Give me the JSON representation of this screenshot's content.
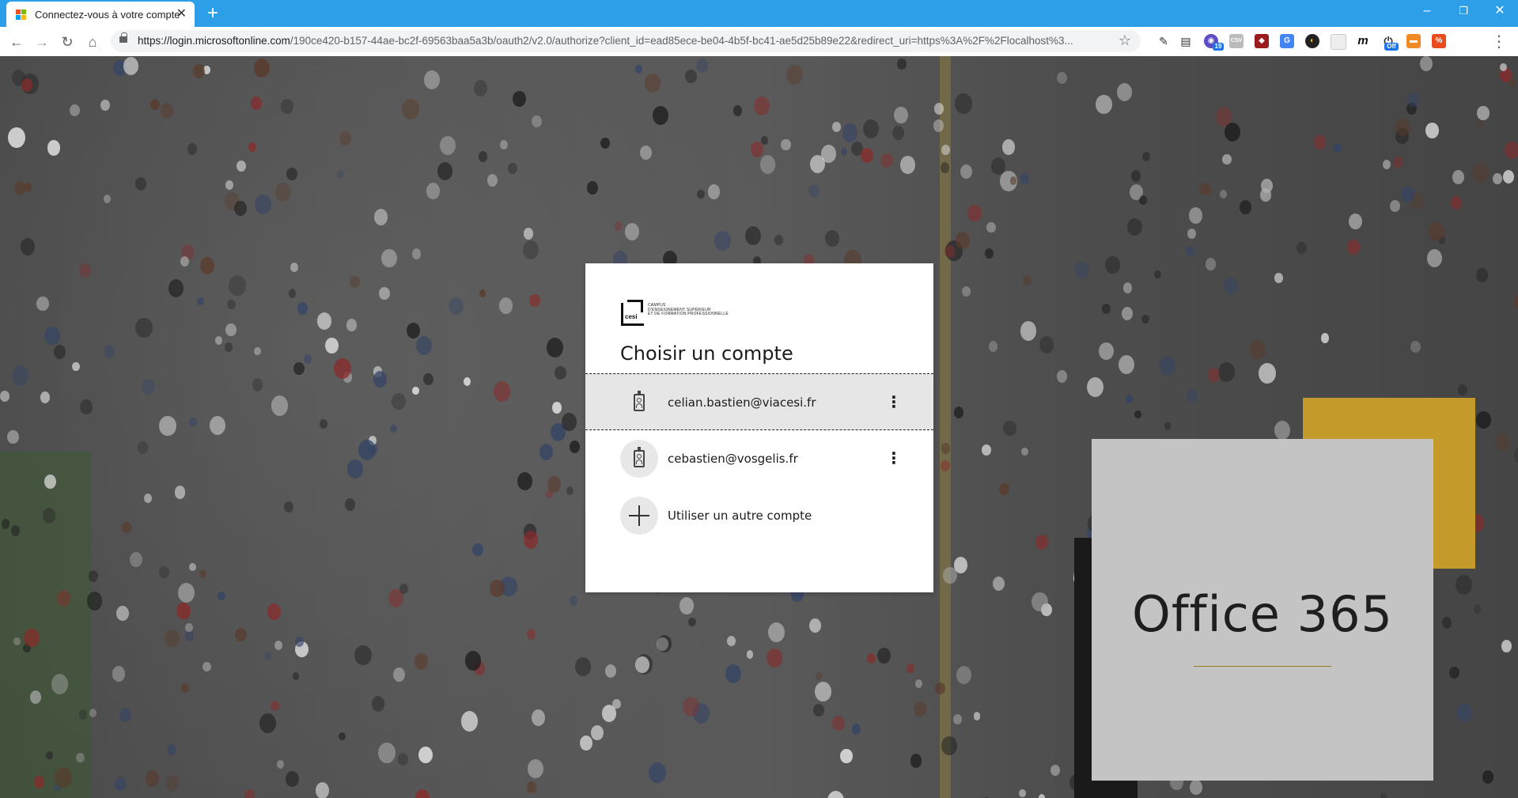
{
  "browser": {
    "tab_title": "Connectez-vous à votre compte",
    "tab_close": "✕",
    "new_tab": "+",
    "window_controls": {
      "minimize": "–",
      "restore": "❐",
      "close": "✕"
    },
    "url_host": "https://login.microsoftonline.com",
    "url_path": "/190ce420-b157-44ae-bc2f-69563baa5a3b/oauth2/v2.0/authorize?client_id=ead85ece-be04-4b5f-bc41-ae5d25b89e22&redirect_uri=https%3A%2F%2Flocalhost%3...",
    "extension_badges": [
      "19",
      "Off"
    ]
  },
  "login": {
    "logo_mark": "cesi",
    "logo_text_lines": [
      "CAMPUS",
      "D'ENSEIGNEMENT SUPÉRIEUR",
      "ET DE FORMATION PROFESSIONNELLE"
    ],
    "heading": "Choisir un compte",
    "accounts": [
      {
        "email": "celian.bastien@viacesi.fr",
        "selected": true
      },
      {
        "email": "cebastien@vosgelis.fr",
        "selected": false
      }
    ],
    "other_account_label": "Utiliser un autre compte"
  },
  "branding": {
    "product": "Office 365",
    "colors": {
      "gold": "#c49a2a",
      "card": "#c4c4c4",
      "chrome_blue": "#2c9fe8"
    }
  }
}
